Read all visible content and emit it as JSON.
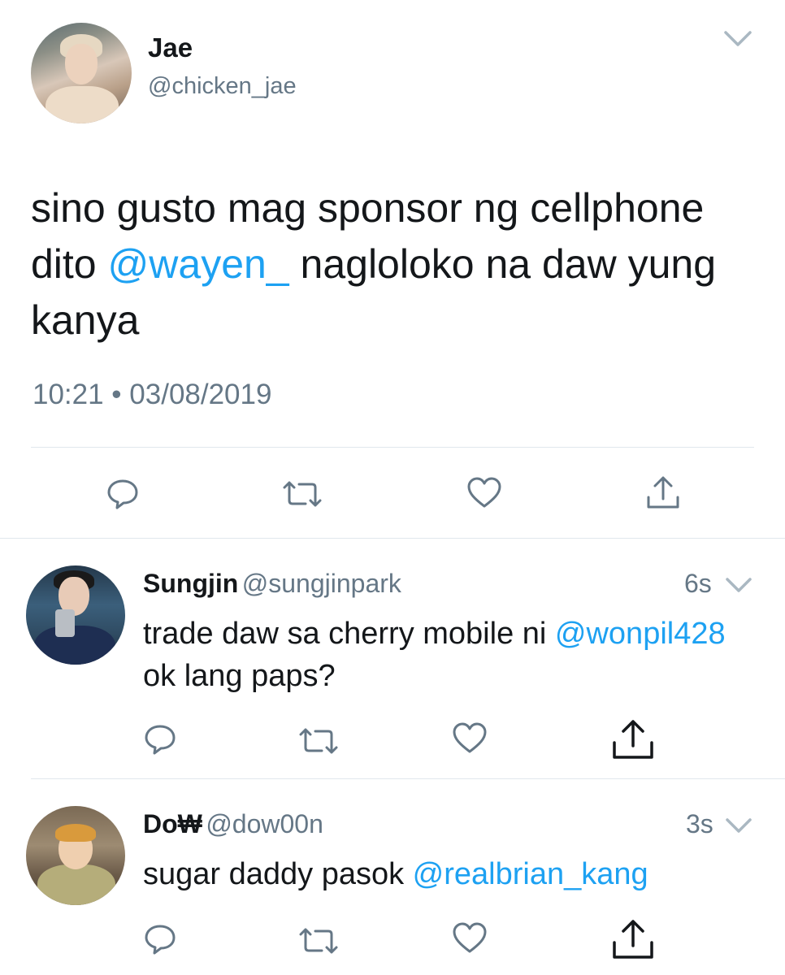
{
  "tweet": {
    "author_name": "Jae",
    "author_handle": "@chicken_jae",
    "text_before": "sino gusto mag sponsor ng cellphone dito ",
    "mention": "@wayen_",
    "text_after": " nagloloko na daw yung kanya",
    "timestamp": "10:21 • 03/08/2019",
    "actions": [
      "reply-icon",
      "retweet-icon",
      "like-icon",
      "share-icon"
    ]
  },
  "replies": [
    {
      "name": "Sungjin",
      "handle": "@sungjinpark",
      "time": "6s",
      "text_before": "trade daw sa cherry mobile ni ",
      "mention": "@wonpil428",
      "text_after": " ok lang paps?"
    },
    {
      "name": "Do₩",
      "handle": "@dow00n",
      "time": "3s",
      "text_before": "sugar daddy pasok ",
      "mention": "@realbrian_kang",
      "text_after": ""
    }
  ],
  "colors": {
    "link": "#1da1f2",
    "secondary_text": "#657786",
    "primary_text": "#14171a",
    "icon": "#657786",
    "divider": "#e1e8ed"
  }
}
